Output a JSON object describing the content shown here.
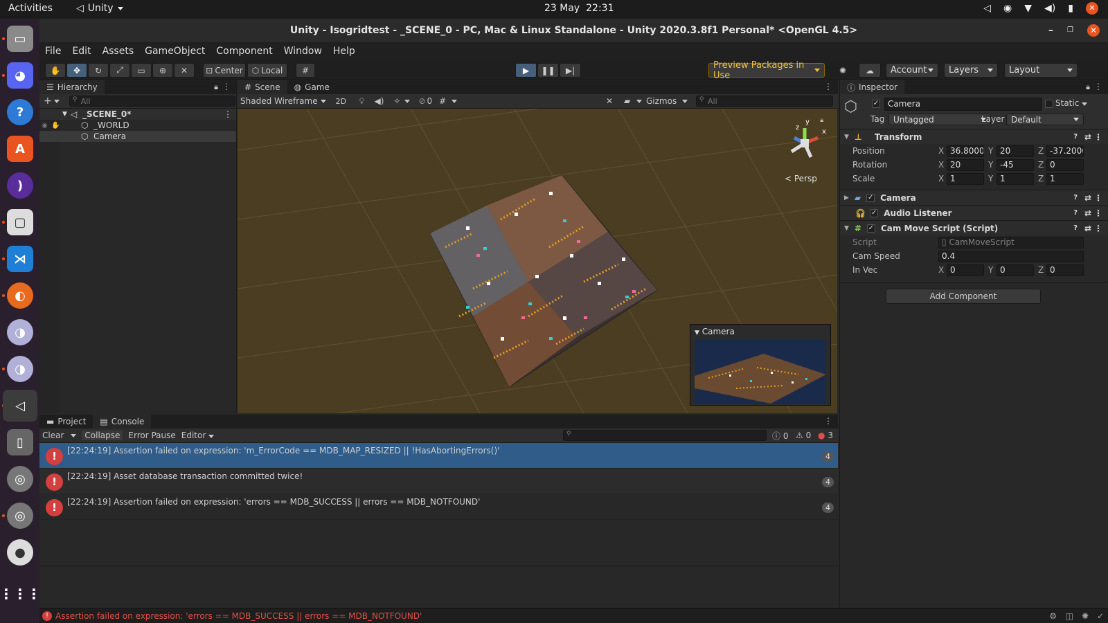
{
  "topbar": {
    "activities": "Activities",
    "app_name": "Unity",
    "date": "23 May",
    "time": "22:31",
    "tray_icons": [
      "unity-tray-icon",
      "discord-tray-icon",
      "wifi-icon",
      "volume-icon",
      "battery-icon",
      "power-icon"
    ]
  },
  "dock": {
    "items": [
      "files",
      "discord",
      "help",
      "app-center",
      "podcasts",
      "twitch",
      "vscode",
      "firefox",
      "blender",
      "blender-2",
      "unity",
      "removable-drive",
      "disc-1",
      "disc-2",
      "dvd",
      "app-grid"
    ]
  },
  "window": {
    "title": "Unity - Isogridtest - _SCENE_0 - PC, Mac & Linux Standalone - Unity 2020.3.8f1 Personal* <OpenGL 4.5>"
  },
  "menu": [
    "File",
    "Edit",
    "Assets",
    "GameObject",
    "Component",
    "Window",
    "Help"
  ],
  "toolbar": {
    "pivot": "Center",
    "space": "Local",
    "preview_packages": "Preview Packages in Use",
    "account": "Account",
    "layers": "Layers",
    "layout": "Layout"
  },
  "hierarchy": {
    "tab": "Hierarchy",
    "search_placeholder": "All",
    "scene": "_SCENE_0*",
    "objects": [
      "_WORLD",
      "Camera"
    ]
  },
  "scene_panel": {
    "tabs": [
      "Scene",
      "Game"
    ],
    "draw_mode": "Shaded Wireframe",
    "mode_2d": "2D",
    "hidden_count": "0",
    "gizmos": "Gizmos",
    "search_placeholder": "All",
    "persp": "Persp",
    "axis_labels": {
      "x": "x",
      "y": "y",
      "z": "z"
    },
    "camera_preview_title": "Camera"
  },
  "inspector": {
    "tab": "Inspector",
    "object_name": "Camera",
    "static_label": "Static",
    "tag_label": "Tag",
    "tag_value": "Untagged",
    "layer_label": "Layer",
    "layer_value": "Default",
    "transform": {
      "title": "Transform",
      "position": {
        "label": "Position",
        "x": "36.8000:",
        "y": "20",
        "z": "-37.2000("
      },
      "rotation": {
        "label": "Rotation",
        "x": "20",
        "y": "-45",
        "z": "0"
      },
      "scale": {
        "label": "Scale",
        "x": "1",
        "y": "1",
        "z": "1"
      }
    },
    "components": [
      "Camera",
      "Audio Listener",
      "Cam Move Script (Script)"
    ],
    "script": {
      "script_label": "Script",
      "script_value": "CamMoveScript",
      "speed_label": "Cam Speed",
      "speed_value": "0.4",
      "invec_label": "In Vec",
      "invec": {
        "x": "0",
        "y": "0",
        "z": "0"
      }
    },
    "add_component": "Add Component"
  },
  "console": {
    "tabs": [
      "Project",
      "Console"
    ],
    "clear": "Clear",
    "collapse": "Collapse",
    "error_pause": "Error Pause",
    "editor": "Editor",
    "info_count": "0",
    "warning_count": "0",
    "error_count": "3",
    "entries": [
      {
        "message": "[22:24:19] Assertion failed on expression: 'm_ErrorCode == MDB_MAP_RESIZED || !HasAbortingErrors()'",
        "count": "4"
      },
      {
        "message": "[22:24:19] Asset database transaction committed twice!",
        "count": "4"
      },
      {
        "message": "[22:24:19] Assertion failed on expression: 'errors == MDB_SUCCESS || errors == MDB_NOTFOUND'",
        "count": "4"
      }
    ]
  },
  "status": {
    "message": "Assertion failed on expression: 'errors == MDB_SUCCESS || errors == MDB_NOTFOUND'"
  },
  "colors": {
    "accent_orange": "#e95420",
    "selected_row": "#2f5c89",
    "error_red": "#d43f3f",
    "play_active": "#46607c",
    "scene_bg": "#4a3d22"
  }
}
